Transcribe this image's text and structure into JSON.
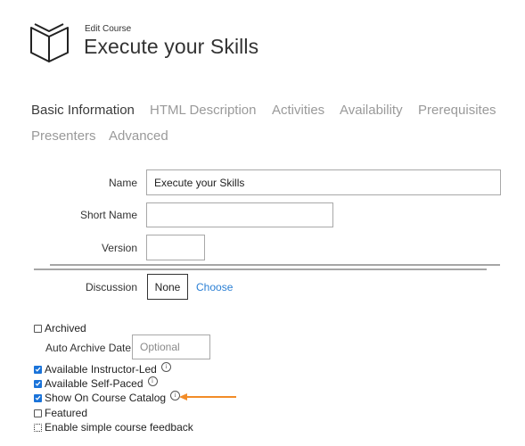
{
  "header": {
    "icon": "book-open-icon",
    "subtitle": "Edit Course",
    "title": "Execute your Skills"
  },
  "tabs": [
    {
      "label": "Basic Information",
      "active": true
    },
    {
      "label": "HTML Description",
      "active": false
    },
    {
      "label": "Activities",
      "active": false
    },
    {
      "label": "Availability",
      "active": false
    },
    {
      "label": "Prerequisites",
      "active": false
    },
    {
      "label": "Presenters",
      "active": false
    },
    {
      "label": "Advanced",
      "active": false
    }
  ],
  "form": {
    "name": {
      "label": "Name",
      "value": "Execute your Skills"
    },
    "short_name": {
      "label": "Short Name",
      "value": ""
    },
    "version": {
      "label": "Version",
      "value": ""
    },
    "discussion": {
      "label": "Discussion",
      "value": "None",
      "choose_label": "Choose"
    }
  },
  "options": {
    "archived": {
      "label": "Archived",
      "checked": false
    },
    "auto_archive_date": {
      "label": "Auto Archive Date",
      "placeholder": "Optional",
      "value": ""
    },
    "checkboxes": [
      {
        "label": "Available Instructor-Led",
        "checked": true,
        "info": true
      },
      {
        "label": "Available Self-Paced",
        "checked": true,
        "info": true
      },
      {
        "label": "Show On Course Catalog",
        "checked": true,
        "info": true,
        "annotated": true
      },
      {
        "label": "Featured",
        "checked": false,
        "info": false
      },
      {
        "label": "Enable simple course feedback",
        "checked": false,
        "info": false,
        "focused": true
      }
    ]
  },
  "annotation": {
    "arrow_color": "#f28c28"
  },
  "info_glyph": "i"
}
